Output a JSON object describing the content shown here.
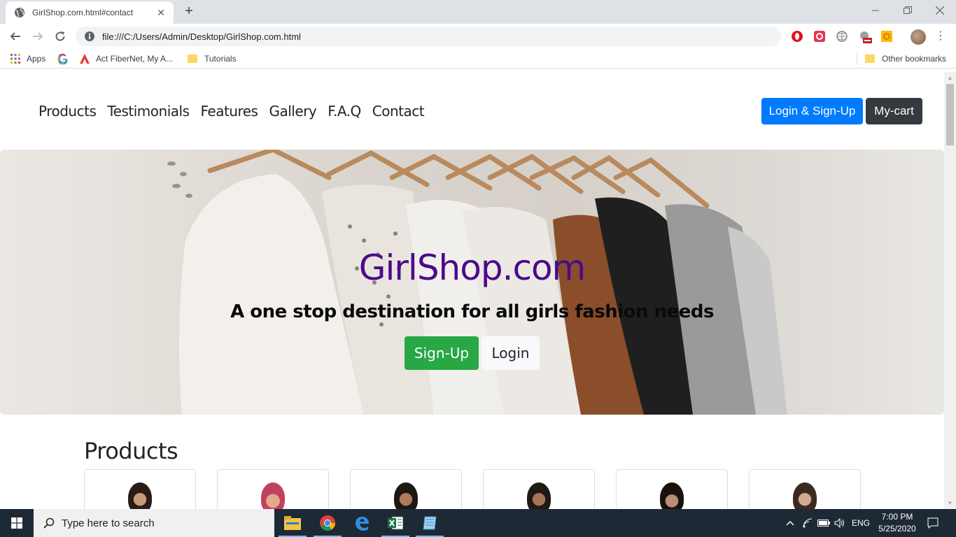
{
  "browser": {
    "tab_title": "GirlShop.com.html#contact",
    "url": "file:///C:/Users/Admin/Desktop/GirlShop.com.html",
    "bookmarks": [
      {
        "label": "Apps",
        "icon": "apps-grid-icon"
      },
      {
        "label": "",
        "icon": "google-icon"
      },
      {
        "label": "Act FiberNet, My A...",
        "icon": "act-fibernet-icon"
      },
      {
        "label": "Tutorials",
        "icon": "folder-icon"
      }
    ],
    "other_bookmarks": "Other bookmarks"
  },
  "site": {
    "nav": [
      "Products",
      "Testimonials",
      "Features",
      "Gallery",
      "F.A.Q",
      "Contact"
    ],
    "login_signup_label": "Login & Sign-Up",
    "cart_label": "My-cart",
    "hero_title": "GirlShop.com",
    "hero_subtitle": "A one stop destination for all girls fashion needs",
    "signup_label": "Sign-Up",
    "login_label": "Login",
    "products_heading": "Products",
    "product_count": 6
  },
  "taskbar": {
    "search_placeholder": "Type here to search",
    "language": "ENG",
    "time": "7:00 PM",
    "date": "5/25/2020"
  },
  "colors": {
    "primary": "#007bff",
    "dark": "#343a40",
    "success": "#28a745",
    "hero_title": "#4b0a8a"
  }
}
